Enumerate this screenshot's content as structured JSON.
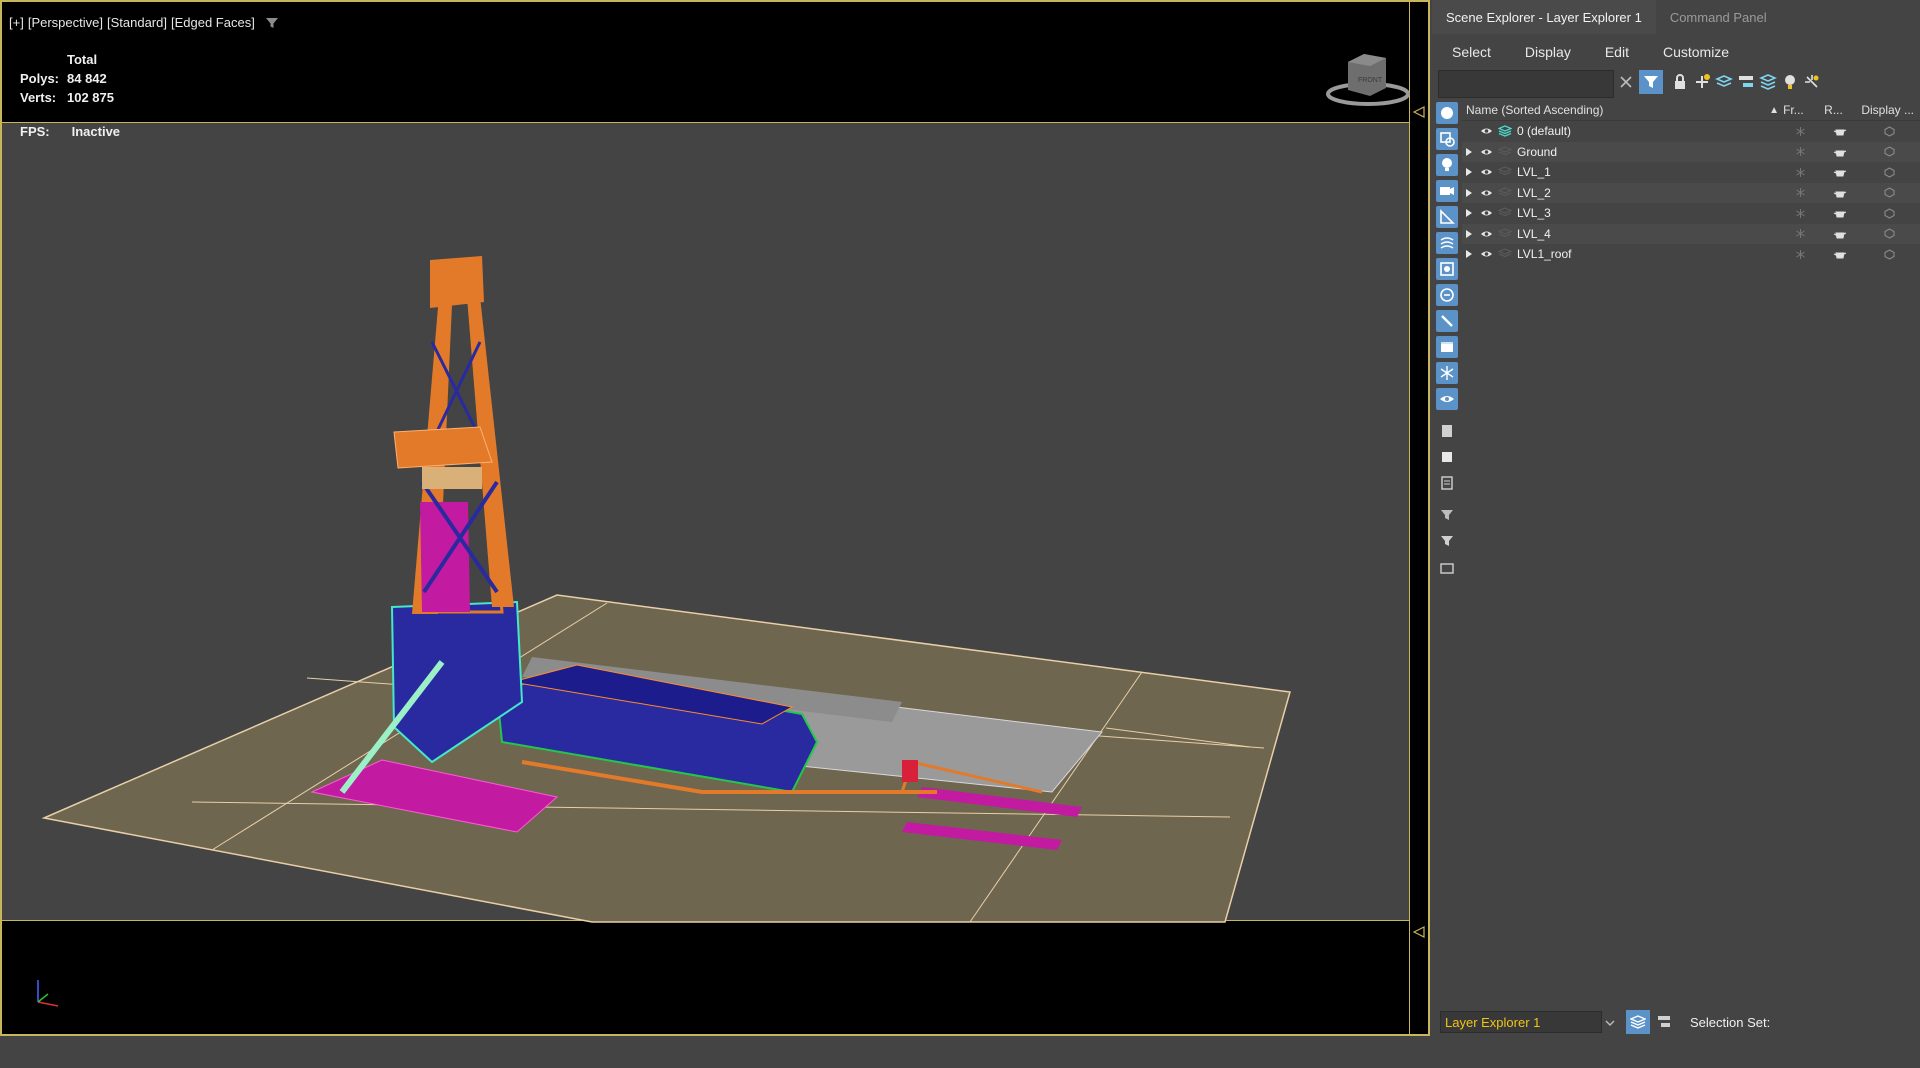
{
  "viewport": {
    "labels": [
      "[+]",
      "[Perspective]",
      "[Standard]",
      "[Edged Faces]"
    ],
    "stats": {
      "title": "Total",
      "polys_label": "Polys:",
      "polys_value": "84 842",
      "verts_label": "Verts:",
      "verts_value": "102 875"
    },
    "fps": {
      "label": "FPS:",
      "value": "Inactive"
    },
    "viewcube_label": "FRONT",
    "colors": {
      "border": "#c9b55a",
      "ground": "#6f6650",
      "derrick": "#e27a2a",
      "magenta": "#c21aa0",
      "blue": "#2a2aa0",
      "green": "#22c84a"
    }
  },
  "panel": {
    "tabs": [
      "Scene Explorer - Layer Explorer 1",
      "Command Panel"
    ],
    "menus": [
      "Select",
      "Display",
      "Edit",
      "Customize"
    ],
    "search": {
      "value": ""
    },
    "columns": {
      "name": "Name (Sorted Ascending)",
      "sort_indicator": "▲",
      "frozen": "Fr...",
      "render": "R...",
      "display": "Display ..."
    },
    "layers": [
      {
        "name": "0 (default)",
        "expandable": false
      },
      {
        "name": "Ground",
        "expandable": true
      },
      {
        "name": "LVL_1",
        "expandable": true
      },
      {
        "name": "LVL_2",
        "expandable": true
      },
      {
        "name": "LVL_3",
        "expandable": true
      },
      {
        "name": "LVL_4",
        "expandable": true
      },
      {
        "name": "LVL1_roof",
        "expandable": true
      }
    ],
    "bottom": {
      "explorer_select": "Layer Explorer 1",
      "selection_set_label": "Selection Set:"
    },
    "colors": {
      "accent": "#5b93c8",
      "explorer_text": "#f0c419"
    }
  }
}
